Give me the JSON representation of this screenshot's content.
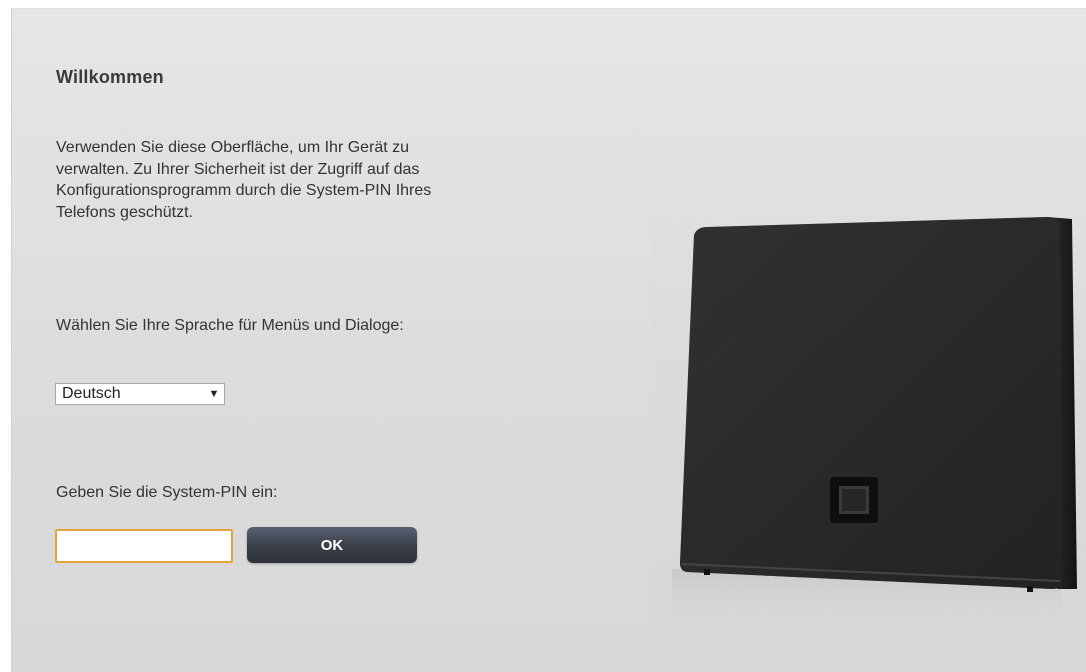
{
  "welcome": {
    "title": "Willkommen",
    "intro": "Verwenden Sie diese Oberfläche, um Ihr Gerät zu verwalten. Zu Ihrer Sicherheit ist der Zugriff auf das Konfigurationsprogramm durch die System-PIN Ihres Telefons geschützt."
  },
  "language": {
    "label": "Wählen Sie Ihre Sprache für Menüs und Dialoge:",
    "selected": "Deutsch",
    "arrow_icon": "▼"
  },
  "pin": {
    "label": "Geben Sie die System-PIN ein:",
    "value": "",
    "ok_label": "OK"
  },
  "colors": {
    "background": "#dcdcdc",
    "input_border": "#e2a33a",
    "button": "#3b404b"
  }
}
